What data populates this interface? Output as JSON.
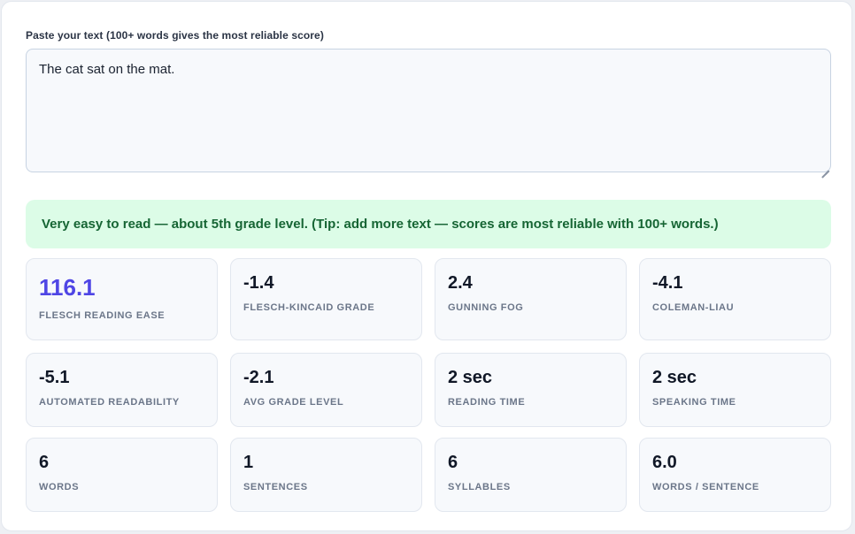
{
  "editor": {
    "label": "Paste your text (100+ words gives the most reliable score)",
    "value": "The cat sat on the mat."
  },
  "verdict": {
    "text": "Very easy to read — about 5th grade level. (Tip: add more text — scores are most reliable with 100+ words.)",
    "background_color": "#dcfce7",
    "text_color": "#166534"
  },
  "accent_color": "#4f46e5",
  "stats": [
    {
      "value": "116.1",
      "label": "FLESCH READING EASE"
    },
    {
      "value": "-1.4",
      "label": "FLESCH-KINCAID GRADE"
    },
    {
      "value": "2.4",
      "label": "GUNNING FOG"
    },
    {
      "value": "-4.1",
      "label": "COLEMAN-LIAU"
    },
    {
      "value": "-5.1",
      "label": "AUTOMATED READABILITY"
    },
    {
      "value": "-2.1",
      "label": "AVG GRADE LEVEL"
    },
    {
      "value": "2 sec",
      "label": "READING TIME"
    },
    {
      "value": "2 sec",
      "label": "SPEAKING TIME"
    },
    {
      "value": "6",
      "label": "WORDS"
    },
    {
      "value": "1",
      "label": "SENTENCES"
    },
    {
      "value": "6",
      "label": "SYLLABLES"
    },
    {
      "value": "6.0",
      "label": "WORDS / SENTENCE"
    }
  ]
}
